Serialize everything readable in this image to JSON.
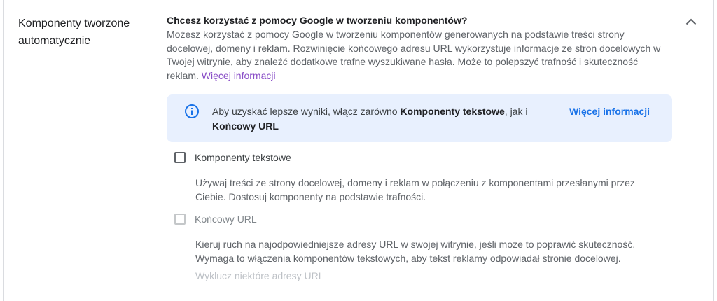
{
  "section": {
    "title": "Komponenty tworzone automatycznie"
  },
  "question": "Chcesz korzystać z pomocy Google w tworzeniu komponentów?",
  "description": {
    "text": "Możesz korzystać z pomocy Google w tworzeniu komponentów generowanych na podstawie treści strony docelowej, domeny i reklam. Rozwinięcie końcowego adresu URL wykorzystuje informacje ze stron docelowych w Twojej witrynie, aby znaleźć dodatkowe trafne wyszukiwane hasła. Może to polepszyć trafność i skuteczność reklam.",
    "link": "Więcej informacji"
  },
  "info_box": {
    "text_prefix": "Aby uzyskać lepsze wyniki, włącz zarówno ",
    "bold_1": "Komponenty tekstowe",
    "text_middle": ", jak i ",
    "bold_2": "Końcowy URL",
    "link": "Więcej informacji",
    "icon": "info-icon"
  },
  "options": [
    {
      "label": "Komponenty tekstowe",
      "checked": false,
      "disabled": false,
      "description": "Używaj treści ze strony docelowej, domeny i reklam w połączeniu z komponentami przesłanymi przez Ciebie. Dostosuj komponenty na podstawie trafności."
    },
    {
      "label": "Końcowy URL",
      "checked": false,
      "disabled": true,
      "description": "Kieruj ruch na najodpowiedniejsze adresy URL w swojej witrynie, jeśli może to poprawić skuteczność. Wymaga to włączenia komponentów tekstowych, aby tekst reklamy odpowiadał stronie docelowej."
    }
  ],
  "exclude_link": "Wyklucz niektóre adresy URL",
  "colors": {
    "link_blue": "#1a73e8",
    "link_purple": "#8a4fc7",
    "info_bg": "#e8f0fe"
  }
}
